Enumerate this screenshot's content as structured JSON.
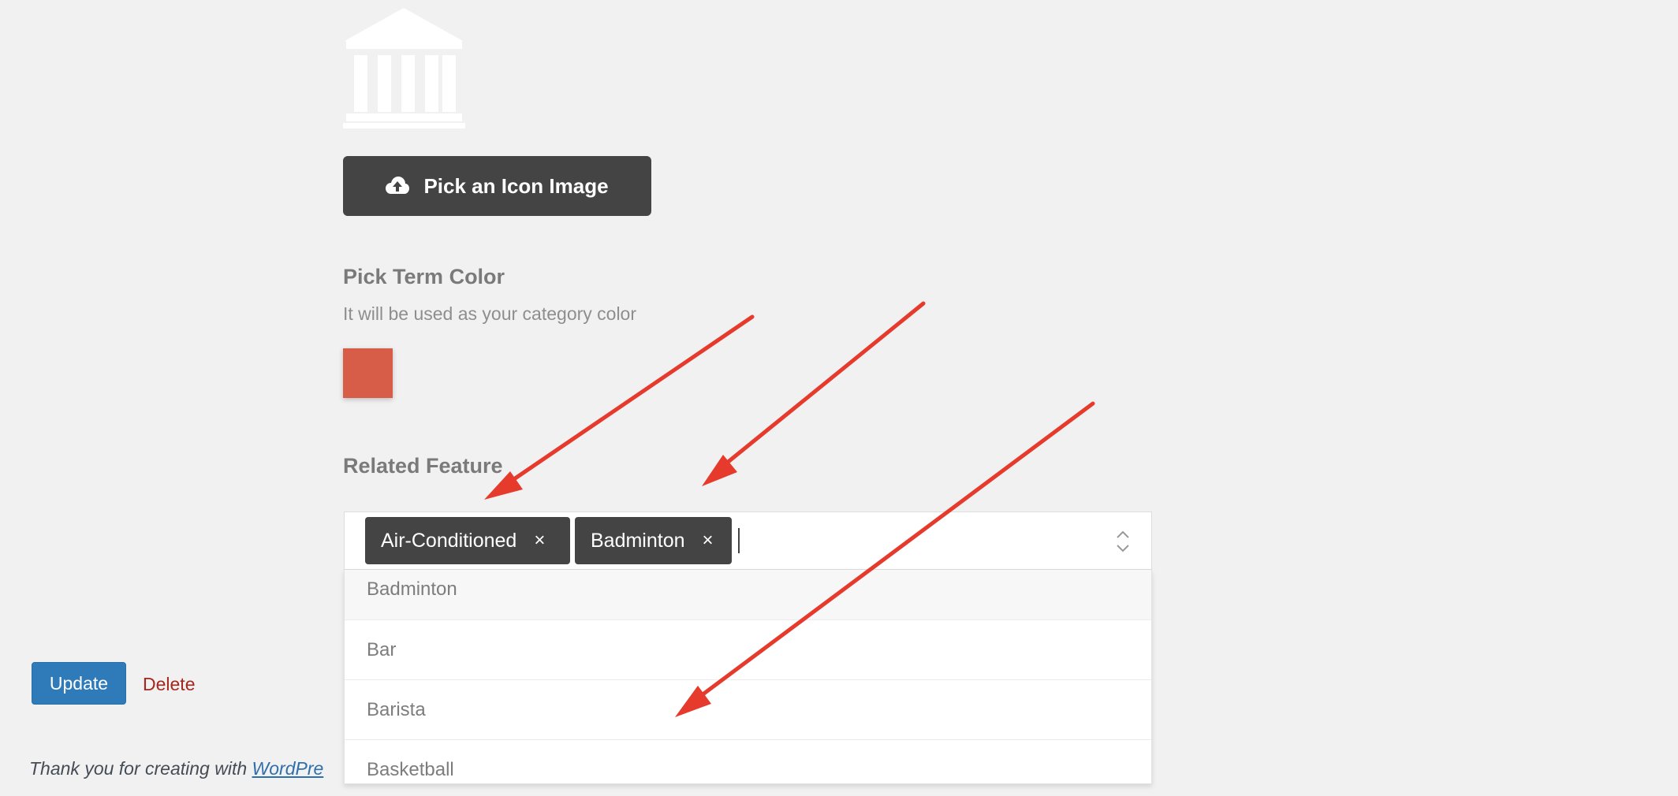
{
  "icon_image": {
    "icon": "museum-building-icon",
    "color": "#ffffff"
  },
  "pick_icon_button": {
    "label": "Pick an Icon Image",
    "icon": "cloud-upload-icon"
  },
  "term_color": {
    "heading": "Pick Term Color",
    "description": "It will be used as your category color",
    "value": "#d75d48"
  },
  "related_feature": {
    "heading": "Related Feature",
    "selected": [
      "Air-Conditioned",
      "Badminton"
    ],
    "remove_glyph": "×",
    "options": [
      "Badminton",
      "Bar",
      "Barista",
      "Basketball"
    ]
  },
  "actions": {
    "update_label": "Update",
    "delete_label": "Delete"
  },
  "footer": {
    "text": "Thank you for creating with ",
    "link_text": "WordPre"
  },
  "colors": {
    "accent_blue": "#2f7ab8",
    "dark_button": "#444444",
    "annotation_red": "#e63a2c",
    "delete_red": "#a3281f"
  }
}
